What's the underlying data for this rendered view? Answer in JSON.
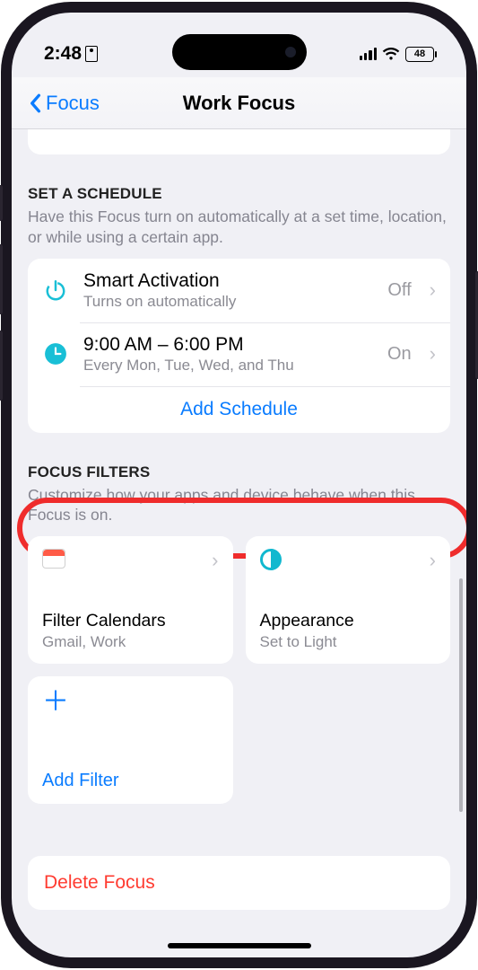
{
  "status": {
    "time": "2:48",
    "battery": "48"
  },
  "nav": {
    "back": "Focus",
    "title": "Work Focus"
  },
  "schedule": {
    "heading": "SET A SCHEDULE",
    "sub": "Have this Focus turn on automatically at a set time, location, or while using a certain app.",
    "rows": [
      {
        "title": "Smart Activation",
        "sub": "Turns on automatically",
        "value": "Off"
      },
      {
        "title": "9:00 AM – 6:00 PM",
        "sub": "Every Mon, Tue, Wed, and Thu",
        "value": "On"
      }
    ],
    "add": "Add Schedule"
  },
  "filters": {
    "heading": "FOCUS FILTERS",
    "sub": "Customize how your apps and device behave when this Focus is on.",
    "cards": [
      {
        "title": "Filter Calendars",
        "sub": "Gmail, Work"
      },
      {
        "title": "Appearance",
        "sub": "Set to Light"
      }
    ],
    "add": "Add Filter"
  },
  "delete": "Delete Focus"
}
